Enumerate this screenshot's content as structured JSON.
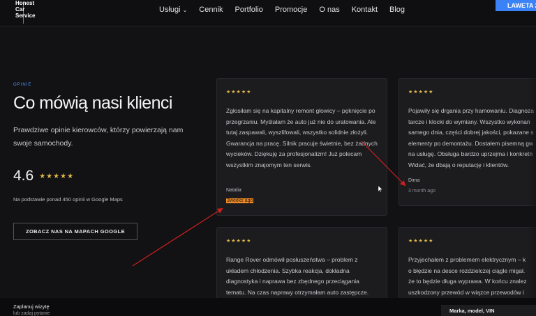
{
  "header": {
    "logo_lines": [
      "Honest",
      "Car",
      "Service"
    ],
    "nav": [
      {
        "label": "Usługi",
        "has_dropdown": true
      },
      {
        "label": "Cennik"
      },
      {
        "label": "Portfolio"
      },
      {
        "label": "Promocje"
      },
      {
        "label": "O nas"
      },
      {
        "label": "Kontakt"
      },
      {
        "label": "Blog"
      }
    ],
    "cta_label": "LAWETA 2"
  },
  "section": {
    "eyebrow": "OPINIE",
    "title": "Co mówią nasi klienci",
    "lead": "Prawdziwe opinie kierowców, którzy powierzają nam swoje samochody.",
    "rating_value": "4.6",
    "rating_stars": "★★★★★",
    "rating_note": "Na podstawie ponad 450 opinii w Google Maps",
    "maps_button": "ZOBACZ NAS NA MAPACH GOOGLE"
  },
  "reviews": [
    {
      "stars": "★★★★★",
      "text": "Zgłosiłam się na kapitalny remont głowicy – pęknięcie po przegrzaniu. Myślałam że auto już nie do uratowania. Ale tutaj zaspawali, wyszlifowali, wszystko solidnie złożyli. Gwarancja na pracę. Silnik pracuje świetnie, bez żadnych wycieków. Dziękuję za profesjonalizm! Już polecam wszystkim znajomym ten serwis.",
      "author": "Natalia",
      "when": "3weeks ago"
    },
    {
      "stars": "★★★★★",
      "lines": [
        "Pojawiły się drgania przy hamowaniu. Diagnoza",
        "tarcze i klocki do wymiany. Wszystko wykonan",
        "samego dnia, części dobrej jakości, pokazane s",
        "elementy po demontażu. Dostałem pisemną gw",
        "na usługę. Obsługa bardzo uprzejma i konkretn",
        "Widać, że dbają o reputację i klientów."
      ],
      "author": "Dima",
      "when": "3 month ago"
    },
    {
      "stars": "★★★★★",
      "text": "Range Rover odmówił posłuszeństwa – problem z układem chłodzenia. Szybka reakcja, dokładna diagnostyka i naprawa bez zbędnego przeciągania tematu. Na czas naprawy otrzymałam auto zastępcze."
    },
    {
      "stars": "★★★★★",
      "lines": [
        "Przyjechałem z problemem elektrycznym – k",
        "o błędzie na desce rozdzielczej ciągle migał.",
        "że to będzie długa wyprawa. W końcu znalez",
        "uszkodzony przewód w wiązce przewodów i"
      ]
    }
  ],
  "bottom_bar": {
    "title": "Zaplanuj wizytę",
    "subtitle": "lub zadaj pytanie",
    "field_label": "Marka, model, VIN"
  },
  "colors": {
    "accent": "#3b82f6",
    "star": "#e0b54a",
    "highlight": "#f28c28",
    "annotation_arrow": "#cc1f1f"
  }
}
